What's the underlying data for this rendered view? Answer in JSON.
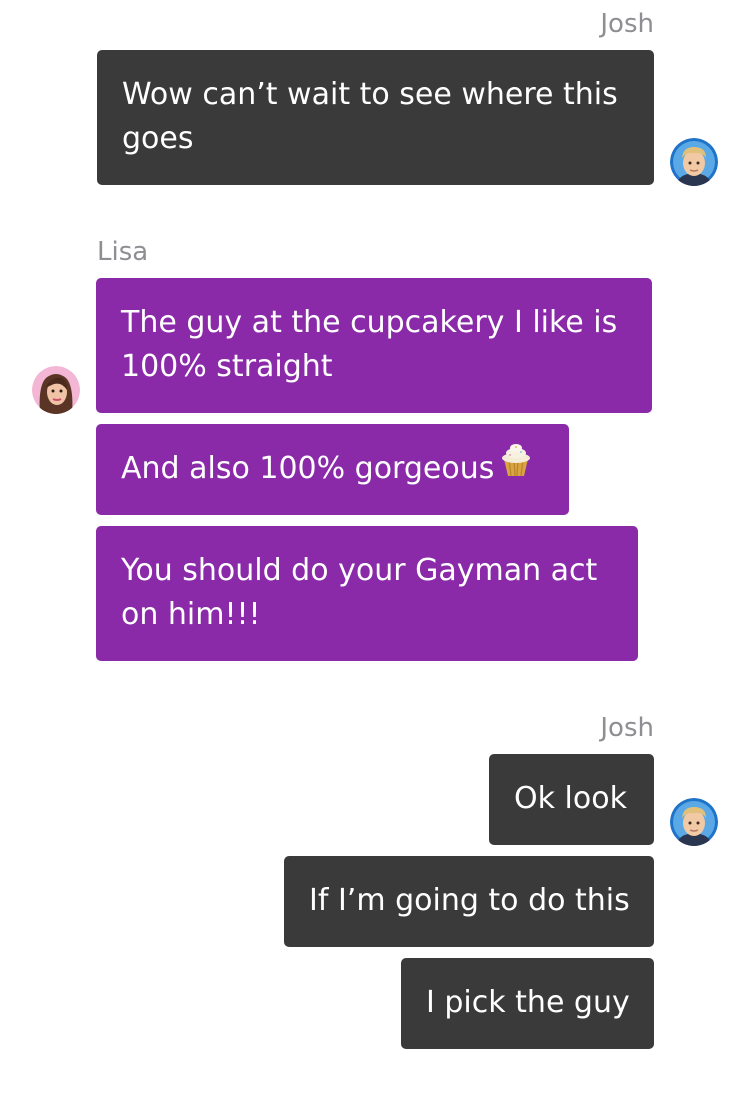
{
  "chat": {
    "groups": [
      {
        "sender": "Josh",
        "side": "right",
        "messages": [
          "Wow can’t wait to see where this goes"
        ]
      },
      {
        "sender": "Lisa",
        "side": "left",
        "messages": [
          "The guy at the cupcakery I like is 100% straight",
          "And also 100% gorgeous",
          "You should do your Gayman act on him!!!"
        ]
      },
      {
        "sender": "Josh",
        "side": "right",
        "messages": [
          "Ok look",
          "If I’m going to do this",
          "I pick the guy"
        ]
      }
    ]
  },
  "icons": {
    "josh_avatar": "josh-avatar-icon",
    "lisa_avatar": "lisa-avatar-icon",
    "cupcake": "cupcake-emoji-icon"
  },
  "colors": {
    "josh_bubble": "#3a3a3a",
    "lisa_bubble": "#8a2aa8",
    "sender_name": "#8e8e93",
    "text": "#ffffff"
  }
}
